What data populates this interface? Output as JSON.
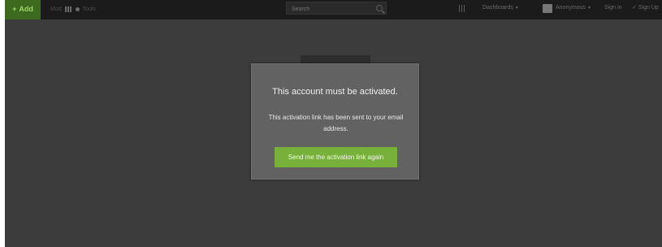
{
  "topbar": {
    "add_label": "Add",
    "add_icon": "plus-icon",
    "left_tools": [
      "Mod",
      "Tools"
    ],
    "search": {
      "placeholder": "Search",
      "value": ""
    },
    "dashboards_label": "Dashboards",
    "user_label": "Anonymous",
    "sign_in_label": "Sign in",
    "sign_up_label": "Sign Up"
  },
  "modal": {
    "title": "This account must be activated.",
    "message": "This activation link has been sent to your email address.",
    "button_label": "Send me the activation link again"
  },
  "colors": {
    "background": "#3c3c3c",
    "topbar": "#1b1b1b",
    "modal": "#626262",
    "accent_green": "#77b03a"
  }
}
